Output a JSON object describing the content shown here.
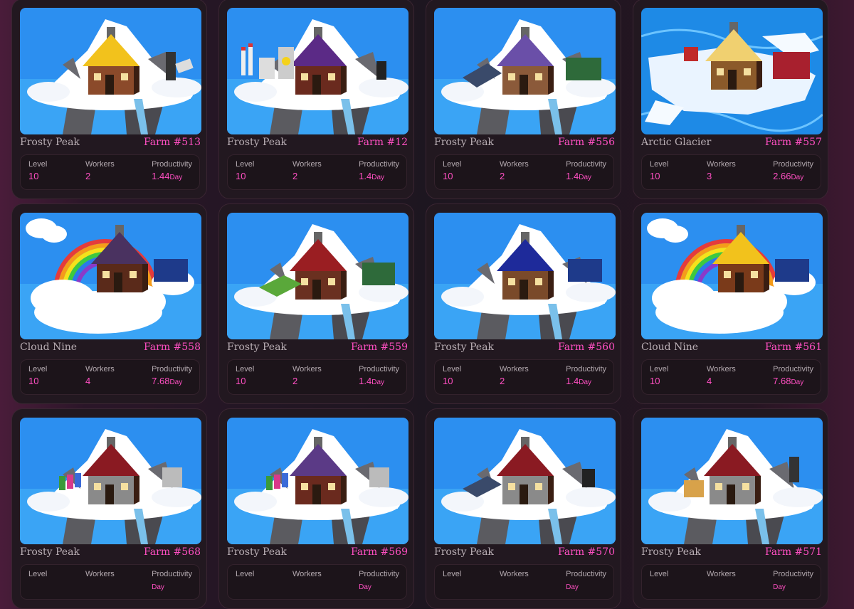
{
  "labels": {
    "level": "Level",
    "workers": "Workers",
    "productivity": "Productivity",
    "per_day": "Day"
  },
  "farms": [
    {
      "name": "Frosty Peak",
      "farm_id": "Farm #513",
      "level": "10",
      "workers": "2",
      "productivity": "1.44",
      "scene": "peak",
      "roof": "#f2c21c",
      "wall": "#8b4a2a",
      "prop": "charger"
    },
    {
      "name": "Frosty Peak",
      "farm_id": "Farm #12",
      "level": "10",
      "workers": "2",
      "productivity": "1.4",
      "scene": "peak",
      "roof": "#5b2a86",
      "wall": "#6a2a1e",
      "prop": "nuclear"
    },
    {
      "name": "Frosty Peak",
      "farm_id": "Farm #556",
      "level": "10",
      "workers": "2",
      "productivity": "1.4",
      "scene": "peak",
      "roof": "#6a4fa8",
      "wall": "#8b5a3a",
      "prop": "solar-container"
    },
    {
      "name": "Arctic Glacier",
      "farm_id": "Farm #557",
      "level": "10",
      "workers": "3",
      "productivity": "2.66",
      "scene": "glacier",
      "roof": "#f0d070",
      "wall": "#8b5a2a",
      "prop": "container-red"
    },
    {
      "name": "Cloud Nine",
      "farm_id": "Farm #558",
      "level": "10",
      "workers": "4",
      "productivity": "7.68",
      "scene": "cloud",
      "roof": "#4a3260",
      "wall": "#5a2a1a",
      "prop": "container-blue"
    },
    {
      "name": "Frosty Peak",
      "farm_id": "Farm #559",
      "level": "10",
      "workers": "2",
      "productivity": "1.4",
      "scene": "peak",
      "roof": "#9a1e22",
      "wall": "#6a3020",
      "prop": "field-container"
    },
    {
      "name": "Frosty Peak",
      "farm_id": "Farm #560",
      "level": "10",
      "workers": "2",
      "productivity": "1.4",
      "scene": "peak",
      "roof": "#1e2a9a",
      "wall": "#7a4a2a",
      "prop": "container-blue"
    },
    {
      "name": "Cloud Nine",
      "farm_id": "Farm #561",
      "level": "10",
      "workers": "4",
      "productivity": "7.68",
      "scene": "cloud",
      "roof": "#f2c21c",
      "wall": "#7a3a1a",
      "prop": "container-blue"
    },
    {
      "name": "Frosty Peak",
      "farm_id": "Farm #568",
      "level": "",
      "workers": "",
      "productivity": "",
      "scene": "peak",
      "roof": "#8a1a22",
      "wall": "#8a8a8a",
      "prop": "generators"
    },
    {
      "name": "Frosty Peak",
      "farm_id": "Farm #569",
      "level": "",
      "workers": "",
      "productivity": "",
      "scene": "peak",
      "roof": "#5b3a86",
      "wall": "#6a2a1e",
      "prop": "generators"
    },
    {
      "name": "Frosty Peak",
      "farm_id": "Farm #570",
      "level": "",
      "workers": "",
      "productivity": "",
      "scene": "peak",
      "roof": "#8a1a22",
      "wall": "#8a8a8a",
      "prop": "solar-bin"
    },
    {
      "name": "Frosty Peak",
      "farm_id": "Farm #571",
      "level": "",
      "workers": "",
      "productivity": "",
      "scene": "peak",
      "roof": "#8a1a22",
      "wall": "#8a8a8a",
      "prop": "mine-charger"
    }
  ]
}
